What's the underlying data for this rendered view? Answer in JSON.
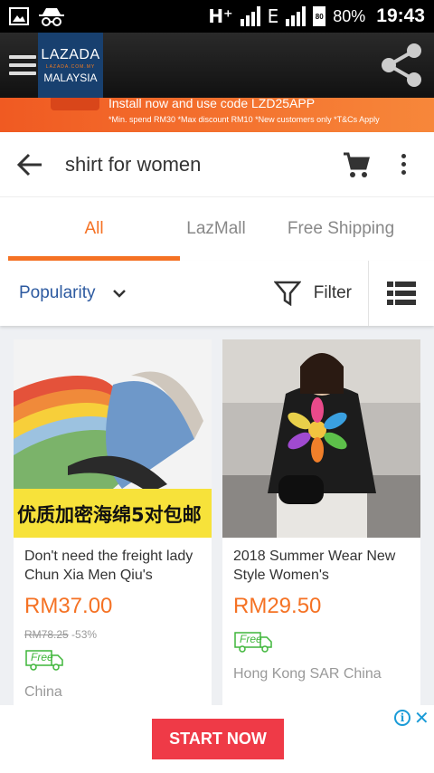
{
  "status_bar": {
    "network": "H⁺",
    "network2": "E",
    "battery_level": "80",
    "battery_percent": "80%",
    "time": "19:43"
  },
  "app_bar": {
    "logo_line1": "LAZADA",
    "logo_line1_sub": "LAZADA.COM.MY",
    "logo_line2": "MALAYSIA",
    "icons": [
      "menu-icon",
      "share-icon"
    ]
  },
  "promo": {
    "line1": "Install now and use code LZD25APP",
    "line2": "*Min. spend RM30 *Max discount RM10 *New customers only *T&Cs Apply"
  },
  "search": {
    "query": "shirt for women"
  },
  "tabs": [
    {
      "label": "All",
      "active": true
    },
    {
      "label": "LazMall",
      "active": false
    },
    {
      "label": "Free Shipping",
      "active": false
    }
  ],
  "sort_bar": {
    "sort_label": "Popularity",
    "filter_label": "Filter"
  },
  "products": [
    {
      "image_caption": "优质加密海绵5对包邮",
      "title": "Don't need the freight lady Chun Xia Men Qiu's",
      "price": "RM37.00",
      "original_price": "RM78.25",
      "discount": "-53%",
      "badge": "Free",
      "origin": "China"
    },
    {
      "title": "2018 Summer Wear New Style Women's",
      "price": "RM29.50",
      "badge": "Free",
      "origin": "Hong Kong SAR China"
    }
  ],
  "ad": {
    "button_label": "START NOW",
    "info": "i",
    "close": "✕"
  },
  "colors": {
    "accent": "#f57224",
    "sort_blue": "#2d5aa0",
    "ad_button": "#ef3a47",
    "logo_bg": "#18406f"
  }
}
